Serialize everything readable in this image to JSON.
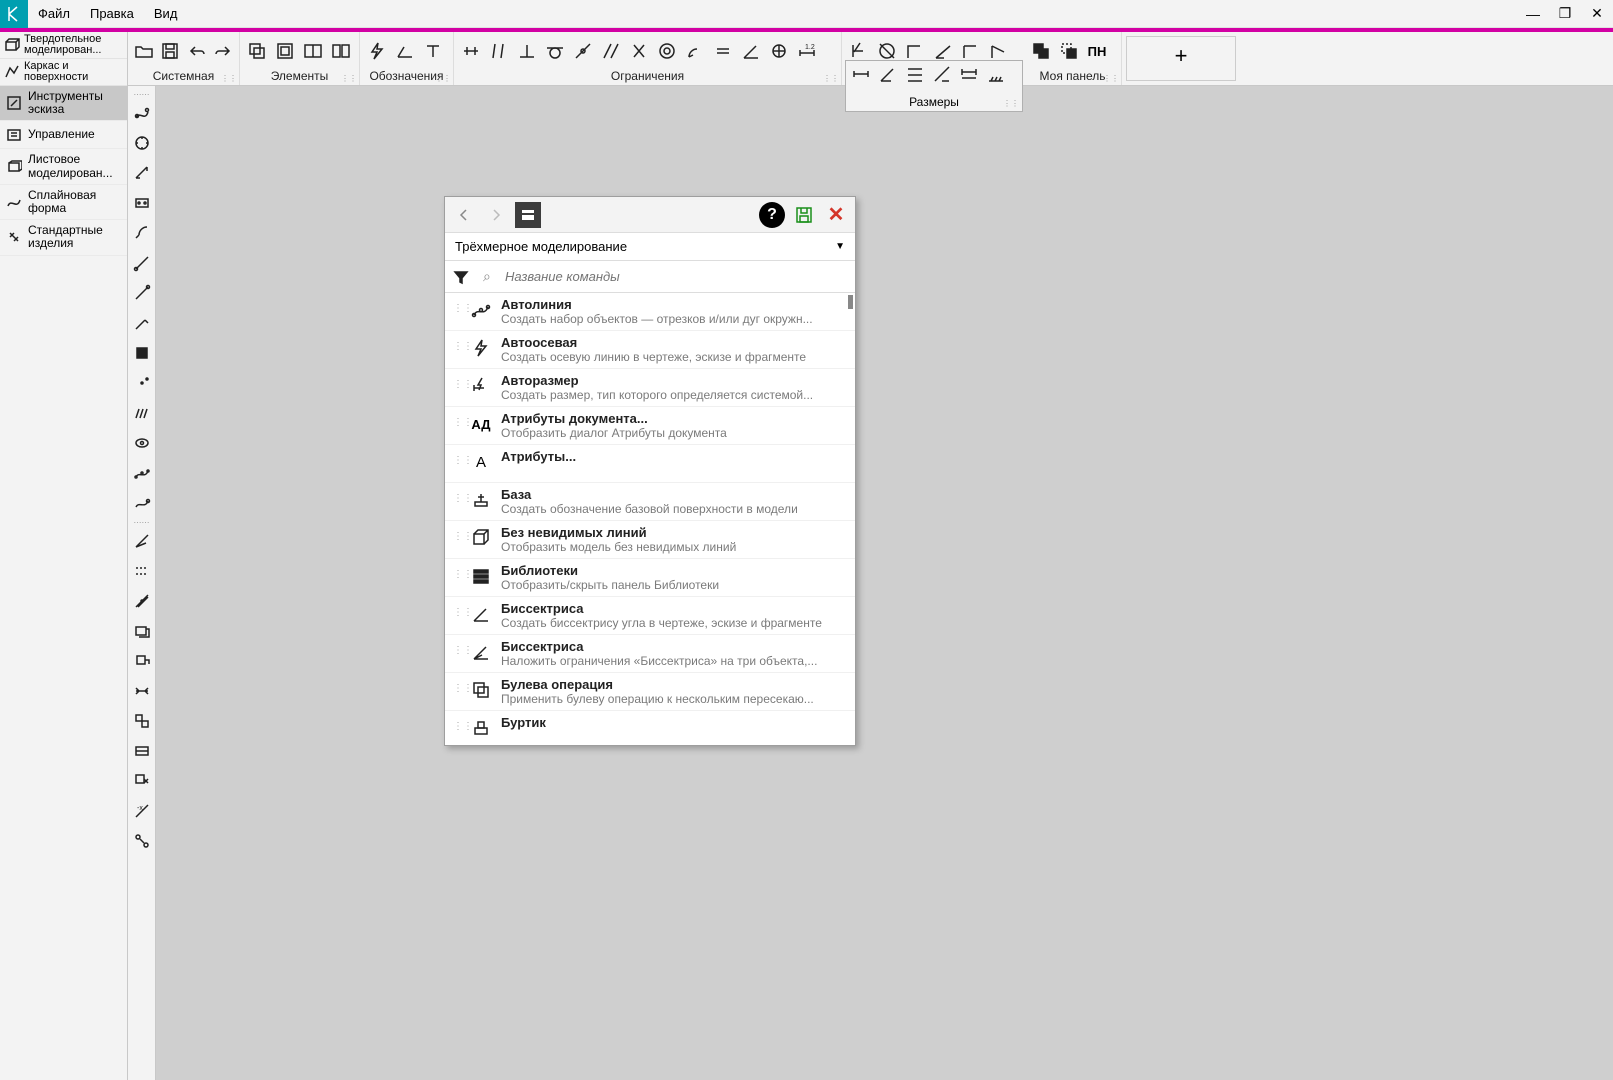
{
  "menu": {
    "items": [
      "Файл",
      "Правка",
      "Вид"
    ]
  },
  "left_toolbar_cats": [
    "Твердотельное моделирован...",
    "Каркас и поверхности"
  ],
  "toolbar_groups": [
    "Системная",
    "Элементы",
    "Обозначения",
    "Ограничения",
    "",
    "Моя панель"
  ],
  "dim_panel": {
    "label": "Размеры"
  },
  "sidebar": {
    "items": [
      {
        "label": "Инструменты эскиза",
        "active": true
      },
      {
        "label": "Управление",
        "active": false
      },
      {
        "label": "Листовое моделирован...",
        "active": false
      },
      {
        "label": "Сплайновая форма",
        "active": false
      },
      {
        "label": "Стандартные изделия",
        "active": false
      }
    ]
  },
  "dialog": {
    "selector": "Трёхмерное моделирование",
    "search_placeholder": "Название команды",
    "items": [
      {
        "title": "Автолиния",
        "desc": "Создать набор объектов — отрезков и/или дуг окружн...",
        "icon": "path"
      },
      {
        "title": "Автоосевая",
        "desc": "Создать осевую линию в чертеже, эскизе и фрагменте",
        "icon": "bolt"
      },
      {
        "title": "Авторазмер",
        "desc": "Создать размер, тип которого определяется системой...",
        "icon": "dimbolt"
      },
      {
        "title": "Атрибуты документа...",
        "desc": "Отобразить диалог Атрибуты документа",
        "icon": "ad"
      },
      {
        "title": "Атрибуты...",
        "desc": "",
        "icon": "a"
      },
      {
        "title": "База",
        "desc": "Создать обозначение базовой поверхности в модели",
        "icon": "base"
      },
      {
        "title": "Без невидимых линий",
        "desc": "Отобразить модель без невидимых линий",
        "icon": "cube"
      },
      {
        "title": "Библиотеки",
        "desc": "Отобразить/скрыть панель Библиотеки",
        "icon": "bars"
      },
      {
        "title": "Биссектриса",
        "desc": "Создать биссектрису угла в чертеже, эскизе и фрагменте",
        "icon": "angle"
      },
      {
        "title": "Биссектриса",
        "desc": "Наложить ограничения «Биссектриса» на три объекта,...",
        "icon": "angle2"
      },
      {
        "title": "Булева операция",
        "desc": "Применить булеву операцию к нескольким пересекаю...",
        "icon": "bool"
      },
      {
        "title": "Буртик",
        "desc": "",
        "icon": "burt"
      }
    ]
  }
}
